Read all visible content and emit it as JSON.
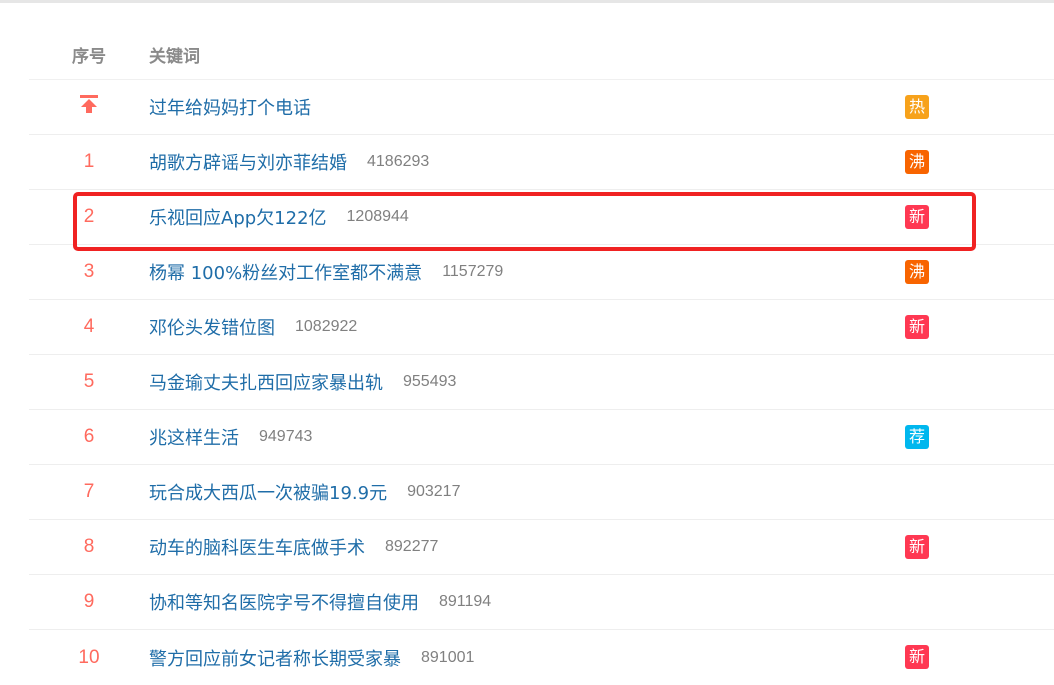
{
  "header": {
    "rank_label": "序号",
    "keyword_label": "关键词"
  },
  "rows": [
    {
      "rank": "",
      "pinned": true,
      "keyword": "过年给妈妈打个电话",
      "count": "",
      "badge": "热",
      "badge_color": "#f7a21b",
      "badge_icon": "hot-badge"
    },
    {
      "rank": "1",
      "keyword": "胡歌方辟谣与刘亦菲结婚",
      "count": "4186293",
      "badge": "沸",
      "badge_color": "#f86400",
      "badge_icon": "boiling-badge"
    },
    {
      "rank": "2",
      "keyword": "乐视回应App欠122亿",
      "count": "1208944",
      "badge": "新",
      "badge_color": "#ff3852",
      "badge_icon": "new-badge"
    },
    {
      "rank": "3",
      "keyword": "杨幂 100%粉丝对工作室都不满意",
      "count": "1157279",
      "badge": "沸",
      "badge_color": "#f86400",
      "badge_icon": "boiling-badge"
    },
    {
      "rank": "4",
      "keyword": "邓伦头发错位图",
      "count": "1082922",
      "badge": "新",
      "badge_color": "#ff3852",
      "badge_icon": "new-badge"
    },
    {
      "rank": "5",
      "keyword": "马金瑜丈夫扎西回应家暴出轨",
      "count": "955493",
      "badge": "",
      "badge_color": "",
      "badge_icon": ""
    },
    {
      "rank": "6",
      "keyword": "兆这样生活",
      "count": "949743",
      "badge": "荐",
      "badge_color": "#00b7ee",
      "badge_icon": "recommend-badge"
    },
    {
      "rank": "7",
      "keyword": "玩合成大西瓜一次被骗19.9元",
      "count": "903217",
      "badge": "",
      "badge_color": "",
      "badge_icon": ""
    },
    {
      "rank": "8",
      "keyword": "动车的脑科医生车底做手术",
      "count": "892277",
      "badge": "新",
      "badge_color": "#ff3852",
      "badge_icon": "new-badge"
    },
    {
      "rank": "9",
      "keyword": "协和等知名医院字号不得擅自使用",
      "count": "891194",
      "badge": "",
      "badge_color": "",
      "badge_icon": ""
    },
    {
      "rank": "10",
      "keyword": "警方回应前女记者称长期受家暴",
      "count": "891001",
      "badge": "新",
      "badge_color": "#ff3852",
      "badge_icon": "new-badge"
    }
  ],
  "colors": {
    "rank": "#ff6a5e",
    "link": "#1f6da8",
    "count": "#808080",
    "highlight": "#f02222"
  }
}
